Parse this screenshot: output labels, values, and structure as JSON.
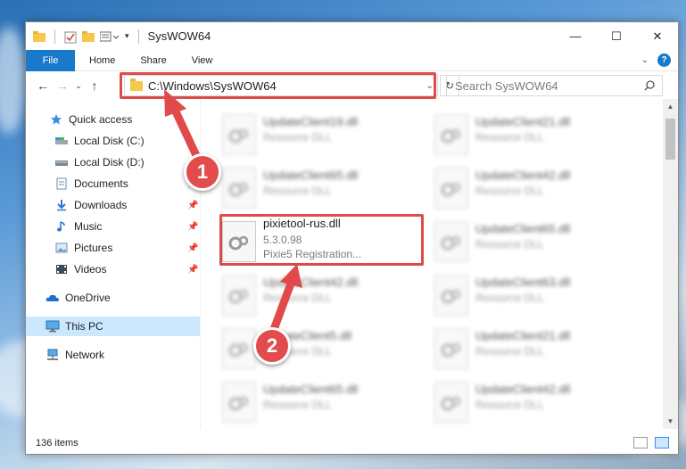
{
  "window": {
    "title": "SysWOW64",
    "controls": {
      "minimize": "—",
      "maximize": "☐",
      "close": "✕"
    }
  },
  "ribbon": {
    "tabs": [
      "File",
      "Home",
      "Share",
      "View"
    ],
    "help": "?"
  },
  "navigation": {
    "address": "C:\\Windows\\SysWOW64",
    "search_placeholder": "Search SysWOW64"
  },
  "sidebar": {
    "items": [
      {
        "label": "Quick access",
        "icon": "star-icon"
      },
      {
        "label": "Local Disk (C:)",
        "icon": "drive-icon"
      },
      {
        "label": "Local Disk (D:)",
        "icon": "drive-icon"
      },
      {
        "label": "Documents",
        "icon": "documents-icon"
      },
      {
        "label": "Downloads",
        "icon": "downloads-icon"
      },
      {
        "label": "Music",
        "icon": "music-icon"
      },
      {
        "label": "Pictures",
        "icon": "pictures-icon"
      },
      {
        "label": "Videos",
        "icon": "videos-icon"
      },
      {
        "label": "OneDrive",
        "icon": "cloud-icon"
      },
      {
        "label": "This PC",
        "icon": "pc-icon"
      },
      {
        "label": "Network",
        "icon": "network-icon"
      }
    ]
  },
  "files": [
    {
      "name": "UpdateClient19.dll",
      "sub": "Resource DLL"
    },
    {
      "name": "UpdateClient21.dll",
      "sub": "Resource DLL"
    },
    {
      "name": "UpdateClient65.dll",
      "sub": "Resource DLL"
    },
    {
      "name": "UpdateClient42.dll",
      "sub": "Resource DLL"
    },
    {
      "name": "pixietool-rus.dll",
      "version": "5.3.0.98",
      "sub": "Pixie5 Registration..."
    },
    {
      "name": "UpdateClient65.dll",
      "sub": "Resource DLL"
    },
    {
      "name": "UpdateClient42.dll",
      "sub": "Resource DLL"
    },
    {
      "name": "UpdateClient63.dll",
      "sub": "Resource DLL"
    },
    {
      "name": "UpdateClient5.dll",
      "sub": "Resource DLL"
    },
    {
      "name": "UpdateClient21.dll",
      "sub": "Resource DLL"
    },
    {
      "name": "UpdateClient65.dll",
      "sub": "Resource DLL"
    },
    {
      "name": "UpdateClient42.dll",
      "sub": "Resource DLL"
    }
  ],
  "status": {
    "item_count": "136 items"
  },
  "annotations": {
    "step1": "1",
    "step2": "2",
    "color": "#e04a4a"
  }
}
